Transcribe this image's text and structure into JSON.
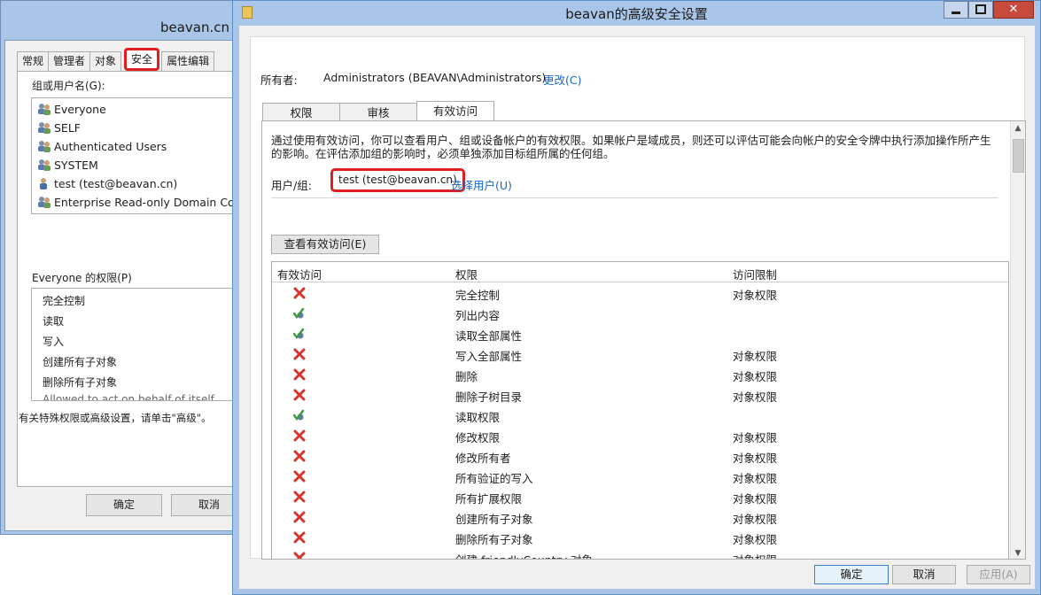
{
  "bg_window": {
    "title": "beavan.cn",
    "tabs": [
      "常规",
      "管理者",
      "对象",
      "安全",
      "属性编辑"
    ],
    "groups_label": "组或用户名(G):",
    "users": [
      {
        "name": "Everyone",
        "icon": "group-icon"
      },
      {
        "name": "SELF",
        "icon": "group-icon"
      },
      {
        "name": "Authenticated Users",
        "icon": "group-icon"
      },
      {
        "name": "SYSTEM",
        "icon": "group-icon"
      },
      {
        "name": "test (test@beavan.cn)",
        "icon": "user-icon"
      },
      {
        "name": "Enterprise Read-only Domain Contr",
        "icon": "group-icon"
      }
    ],
    "perm_label": "Everyone 的权限(P)",
    "perms": [
      "完全控制",
      "读取",
      "写入",
      "创建所有子对象",
      "删除所有子对象",
      "Allowed to act on behalf of itself"
    ],
    "note": "有关特殊权限或高级设置，请单击\"高级\"。",
    "ok": "确定",
    "cancel": "取消"
  },
  "dialog": {
    "title": "beavan的高级安全设置",
    "close": "✕",
    "owner_label": "所有者:",
    "owner_value": "Administrators (BEAVAN\\Administrators)",
    "change_link": "更改(C)",
    "tabs": [
      "权限",
      "审核",
      "有效访问"
    ],
    "description": "通过使用有效访问，你可以查看用户、组或设备帐户的有效权限。如果帐户是域成员，则还可以评估可能会向帐户的安全令牌中执行添加操作所产生的影响。在评估添加组的影响时，必须单独添加目标组所属的任何组。",
    "user_group_label": "用户/组:",
    "user_group_value": "test (test@beavan.cn)",
    "select_user": "选择用户(U)",
    "view_button": "查看有效访问(E)",
    "grid": {
      "headers": [
        "有效访问",
        "权限",
        "访问限制"
      ],
      "rows": [
        {
          "status": "deny",
          "permission": "完全控制",
          "limit": "对象权限"
        },
        {
          "status": "allow",
          "permission": "列出内容",
          "limit": ""
        },
        {
          "status": "allow",
          "permission": "读取全部属性",
          "limit": ""
        },
        {
          "status": "deny",
          "permission": "写入全部属性",
          "limit": "对象权限"
        },
        {
          "status": "deny",
          "permission": "删除",
          "limit": "对象权限"
        },
        {
          "status": "deny",
          "permission": "删除子树目录",
          "limit": "对象权限"
        },
        {
          "status": "allow",
          "permission": "读取权限",
          "limit": ""
        },
        {
          "status": "deny",
          "permission": "修改权限",
          "limit": "对象权限"
        },
        {
          "status": "deny",
          "permission": "修改所有者",
          "limit": "对象权限"
        },
        {
          "status": "deny",
          "permission": "所有验证的写入",
          "limit": "对象权限"
        },
        {
          "status": "deny",
          "permission": "所有扩展权限",
          "limit": "对象权限"
        },
        {
          "status": "deny",
          "permission": "创建所有子对象",
          "limit": "对象权限"
        },
        {
          "status": "deny",
          "permission": "删除所有子对象",
          "limit": "对象权限"
        },
        {
          "status": "deny",
          "permission": "创建 friendlyCountry 对象",
          "limit": "对象权限"
        }
      ]
    },
    "ok": "确定",
    "cancel": "取消",
    "apply": "应用(A)"
  },
  "colors": {
    "deny": "#d9342b",
    "allow": "#3a9a3a",
    "highlight": "#e02020",
    "link": "#1a66c6"
  }
}
